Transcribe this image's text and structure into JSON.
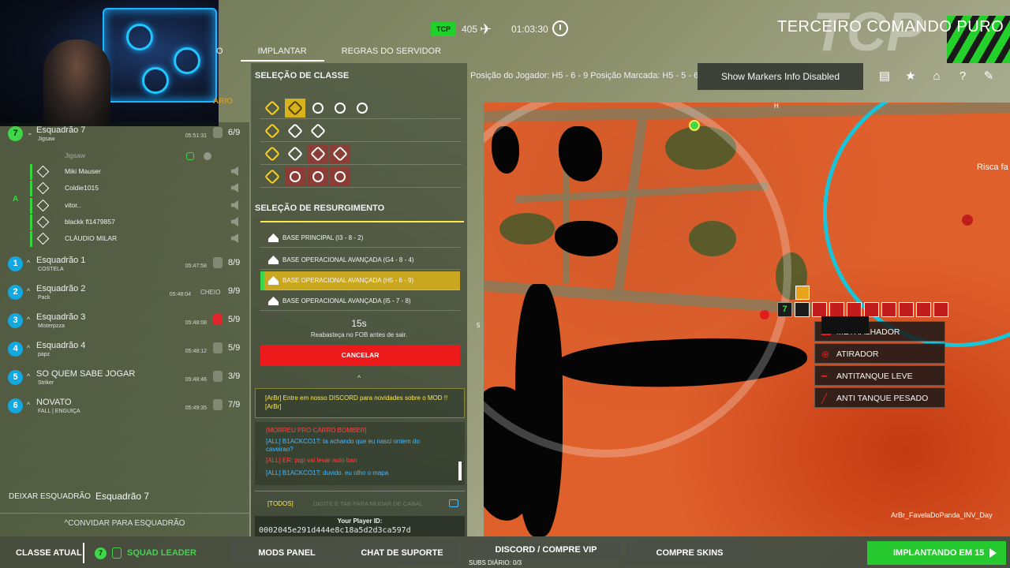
{
  "top": {
    "tcp_badge": "TCP",
    "ticket_count": "405",
    "timer": "01:03:30",
    "team_name": "TERCEIRO COMANDO PURO",
    "team_logo_text": "TCP"
  },
  "nav": {
    "partial_tab": "O",
    "tabs": [
      {
        "label": "IMPLANTAR",
        "active": true
      },
      {
        "label": "REGRAS DO SERVIDOR",
        "active": false
      }
    ]
  },
  "role_tag": "ARIO",
  "squads": {
    "mine": {
      "number": "7",
      "name": "Esquadrão 7",
      "leader": "Jigsaw",
      "time": "05:51:31",
      "count": "6/9",
      "members": [
        "Jigsaw",
        "Miki Mauser",
        "Coldie1015",
        "vitor..",
        "blackk fl1479857",
        "CLÁUDIO MILAR"
      ],
      "leader_marker": "A"
    },
    "others": [
      {
        "number": "1",
        "name": "Esquadrão 1",
        "leader": "COSTELA",
        "time": "05:47:58",
        "status": "",
        "count": "8/9",
        "locked": false
      },
      {
        "number": "2",
        "name": "Esquadrão 2",
        "leader": "Pack",
        "time": "05:48:04",
        "status": "CHEIO",
        "count": "9/9",
        "locked": false
      },
      {
        "number": "3",
        "name": "Esquadrão 3",
        "leader": "Misterpzza",
        "time": "05:48:08",
        "status": "",
        "count": "5/9",
        "locked": true
      },
      {
        "number": "4",
        "name": "Esquadrão 4",
        "leader": "papz",
        "time": "05:48:12",
        "status": "",
        "count": "5/9",
        "locked": false
      },
      {
        "number": "5",
        "name": "SO QUEM SABE JOGAR",
        "leader": "Striker",
        "time": "05:48:46",
        "status": "",
        "count": "3/9",
        "locked": false
      },
      {
        "number": "6",
        "name": "NOVATO",
        "leader": "FALL | ENGUIÇA",
        "time": "05:49:35",
        "status": "",
        "count": "7/9",
        "locked": false
      }
    ],
    "leave_label": "DEIXAR ESQUADRÃO",
    "leave_squad": "Esquadrão 7",
    "invite_label": "CONVIDAR PARA ESQUADRÃO"
  },
  "class_selection": {
    "title": "SELEÇÃO DE CLASSE"
  },
  "respawn": {
    "title": "SELEÇÃO DE RESURGIMENTO",
    "options": [
      {
        "label": "BASE PRINCIPAL (I3 - 8 - 2)",
        "selected": false
      },
      {
        "label": "BASE OPERACIONAL AVANÇADA (G4 - 8 - 4)",
        "selected": false
      },
      {
        "label": "BASE OPERACIONAL AVANÇADA (H5 - 6 - 9)",
        "selected": true
      },
      {
        "label": "BASE OPERACIONAL AVANÇADA (I5 - 7 - 8)",
        "selected": false
      }
    ],
    "timer": "15s",
    "note": "Reabasteça no FOB antes de sair.",
    "cancel": "CANCELAR"
  },
  "chat": {
    "system": "[ArBr] Entre em nosso DISCORD para novidades sobre o MOD !! [ArBr]",
    "lines": [
      {
        "text": "[MORREU PRO CARRO BOMBER]",
        "color": "red"
      },
      {
        "text": "[ALL] B1ACKCO1T: ta achando que eu nasci ontem do caveirao?",
        "color": "blue"
      },
      {
        "text": "[ALL] ER: pqp vai levar auto ban",
        "color": "red"
      },
      {
        "text": "[ALL] B1ACKCO1T: duvido. eu olho o mapa",
        "color": "blue"
      }
    ],
    "channel": "[TODOS]",
    "placeholder": "DIGITE E TAB PARA MUDAR DE CANAL",
    "player_id_label": "Your Player ID:",
    "player_id": "0002045e291d444e8c18a5d2d3ca597d"
  },
  "map_header": {
    "position": "Posição do Jogador: H5 - 6 - 9   Posição Marcada: H5 - 5 - 6",
    "markers_button": "Show Markers Info Disabled",
    "icons": [
      "chat-icon",
      "star-icon",
      "question-house-icon",
      "question-icon",
      "wrench-icon"
    ]
  },
  "map": {
    "grid_label_top": "H",
    "grid_label_side": "5",
    "place_label": "Risca fa",
    "map_name": "ArBr_FavelaDoPanda_INV_Day",
    "marker_number": "7",
    "context_menu": [
      {
        "label": "METRALHADOR",
        "icon": "machinegun-icon"
      },
      {
        "label": "ATIRADOR",
        "icon": "crosshair-icon"
      },
      {
        "label": "ANTITANQUE LEVE",
        "icon": "light-at-icon"
      },
      {
        "label": "ANTI TANQUE PESADO",
        "icon": "heavy-at-icon"
      }
    ]
  },
  "bottom": {
    "current_class_label": "CLASSE ATUAL",
    "class_number": "7",
    "class_name": "SQUAD LEADER",
    "mods_panel": "MODS PANEL",
    "support_chat": "CHAT DE SUPORTE",
    "discord": "DISCORD  /  COMPRE VIP",
    "subs": "SUBS DIÁRIO: 0/3",
    "buy_skins": "COMPRE SKINS",
    "deploy": "IMPLANTANDO EM 15"
  },
  "colors": {
    "accent_green": "#3fd64a",
    "squad_blue": "#14a8e0",
    "selected_yellow": "#c9a71f",
    "cancel_red": "#ec1a1a",
    "map_orange": "#e0602c"
  }
}
